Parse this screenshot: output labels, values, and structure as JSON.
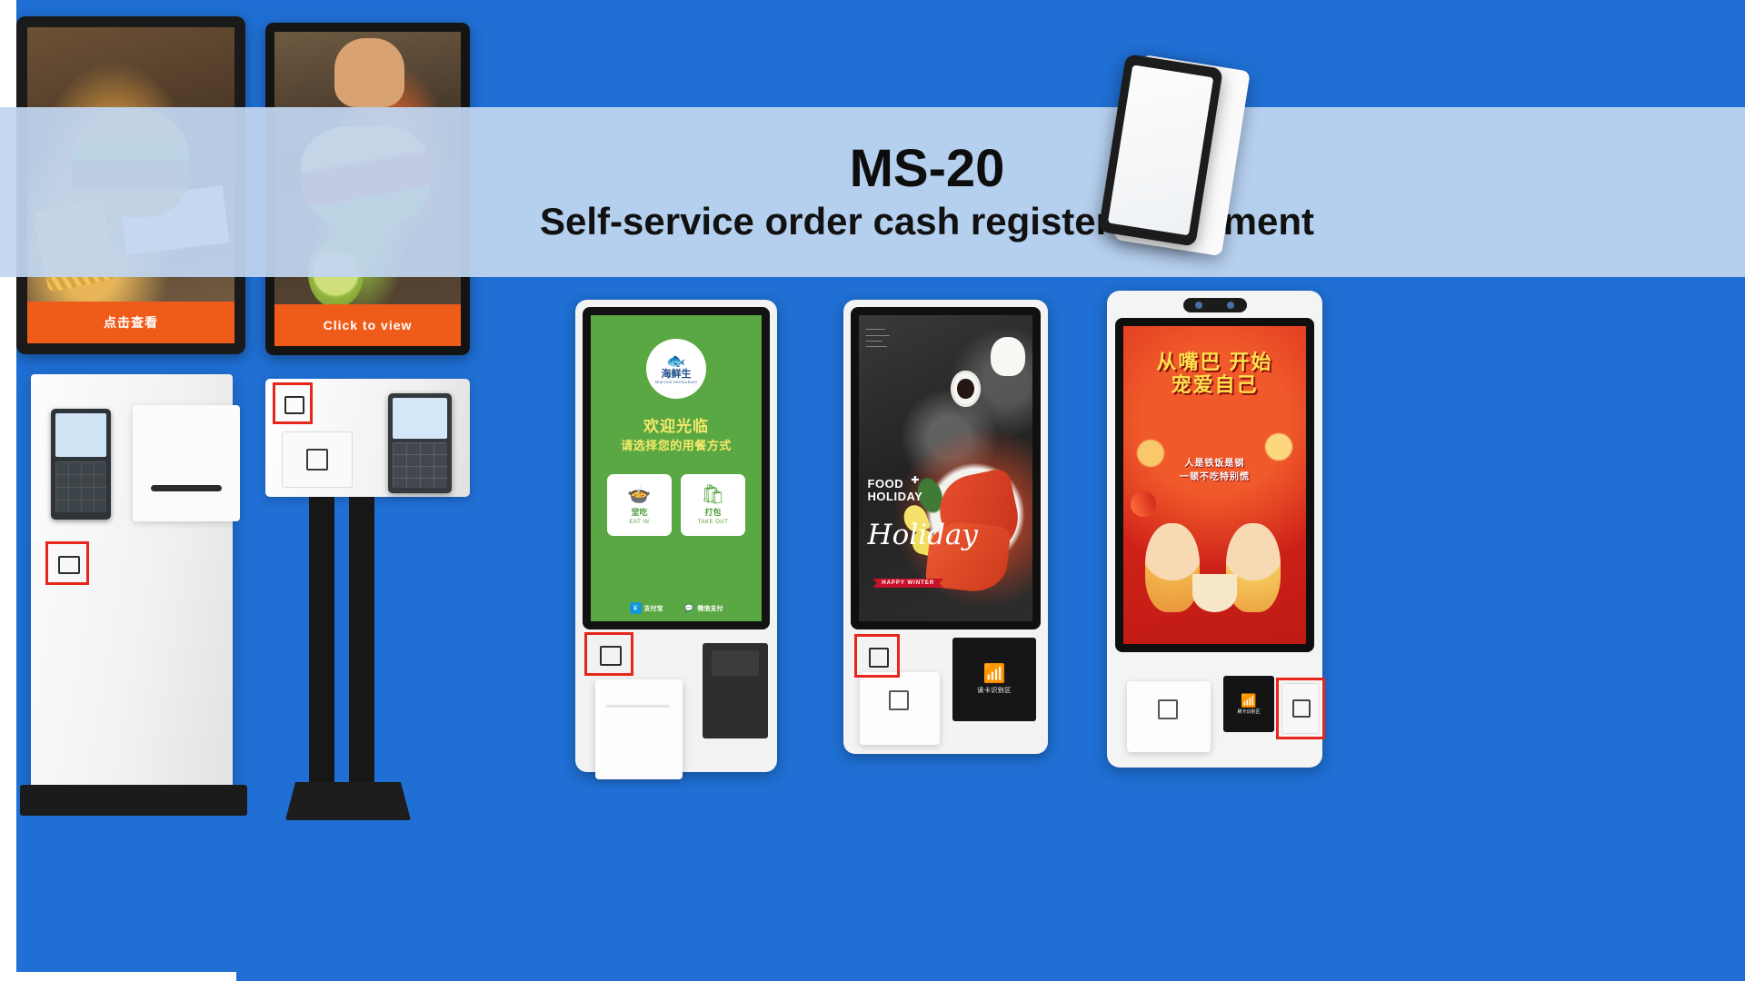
{
  "banner": {
    "title": "MS-20",
    "subtitle": "Self-service order cash register equipment",
    "band_color": "#c1d6f1"
  },
  "background": {
    "color": "#1f6fd4"
  },
  "products": [
    {
      "id": "kiosk-floor-stand-cn",
      "screen": {
        "type": "food-photo-burger",
        "cta_label": "点击查看",
        "cta_color": "#ef5c1a"
      },
      "modules": [
        "pos-terminal",
        "printer-slot",
        "qr-scanner"
      ],
      "scanner_highlight": true
    },
    {
      "id": "kiosk-floor-stand-en",
      "screen": {
        "type": "food-photo-taco",
        "cta_label": "Click to view",
        "cta_color": "#ef5c1a"
      },
      "modules": [
        "qr-scanner",
        "printer",
        "handheld-pda"
      ],
      "scanner_highlight": true
    },
    {
      "id": "kiosk-wall-green",
      "screen": {
        "type": "order-ui-green",
        "bg_color": "#5aa843",
        "logo": {
          "brand_cn": "海鲜生",
          "mark": "fish-logo",
          "tagline": "SEAFOOD RESTAURANT"
        },
        "welcome": "欢迎光临",
        "prompt": "请选择您的用餐方式",
        "options": [
          {
            "icon": "bowl-icon",
            "cn": "堂吃",
            "en": "EAT IN"
          },
          {
            "icon": "bag-icon",
            "cn": "打包",
            "en": "TAKE OUT"
          }
        ],
        "payments": [
          {
            "name": "支付宝",
            "brand": "alipay",
            "color": "#1296db"
          },
          {
            "name": "微信支付",
            "brand": "wechat-pay",
            "color": "#4caf50"
          }
        ]
      },
      "modules": [
        "qr-scanner",
        "thermal-printer",
        "card-module"
      ],
      "scanner_highlight": true
    },
    {
      "id": "kiosk-wall-seafood",
      "screen": {
        "type": "poster-seafood",
        "heading_line1": "FOOD",
        "heading_line2": "HOLIDAY",
        "script_text": "Holiday",
        "ribbon": "HAPPY WINTER"
      },
      "modules": [
        "qr-scanner",
        "printer",
        "nfc-reader"
      ],
      "nfc_label": "读卡识别区",
      "scanner_highlight": true
    },
    {
      "id": "kiosk-wall-red-promo",
      "screen": {
        "type": "poster-red-promo",
        "headline": "从嘴巴\n开始\n宠爱自己",
        "subline1": "人是铁饭是钢",
        "subline2": "一顿不吃特别慌"
      },
      "modules": [
        "camera-bar",
        "printer",
        "nfc-reader",
        "qr-scanner"
      ],
      "nfc_label": "刷卡识别区",
      "scanner_highlight": true
    }
  ],
  "accessory": {
    "id": "handheld-tablet",
    "type": "tablet-terminal"
  }
}
